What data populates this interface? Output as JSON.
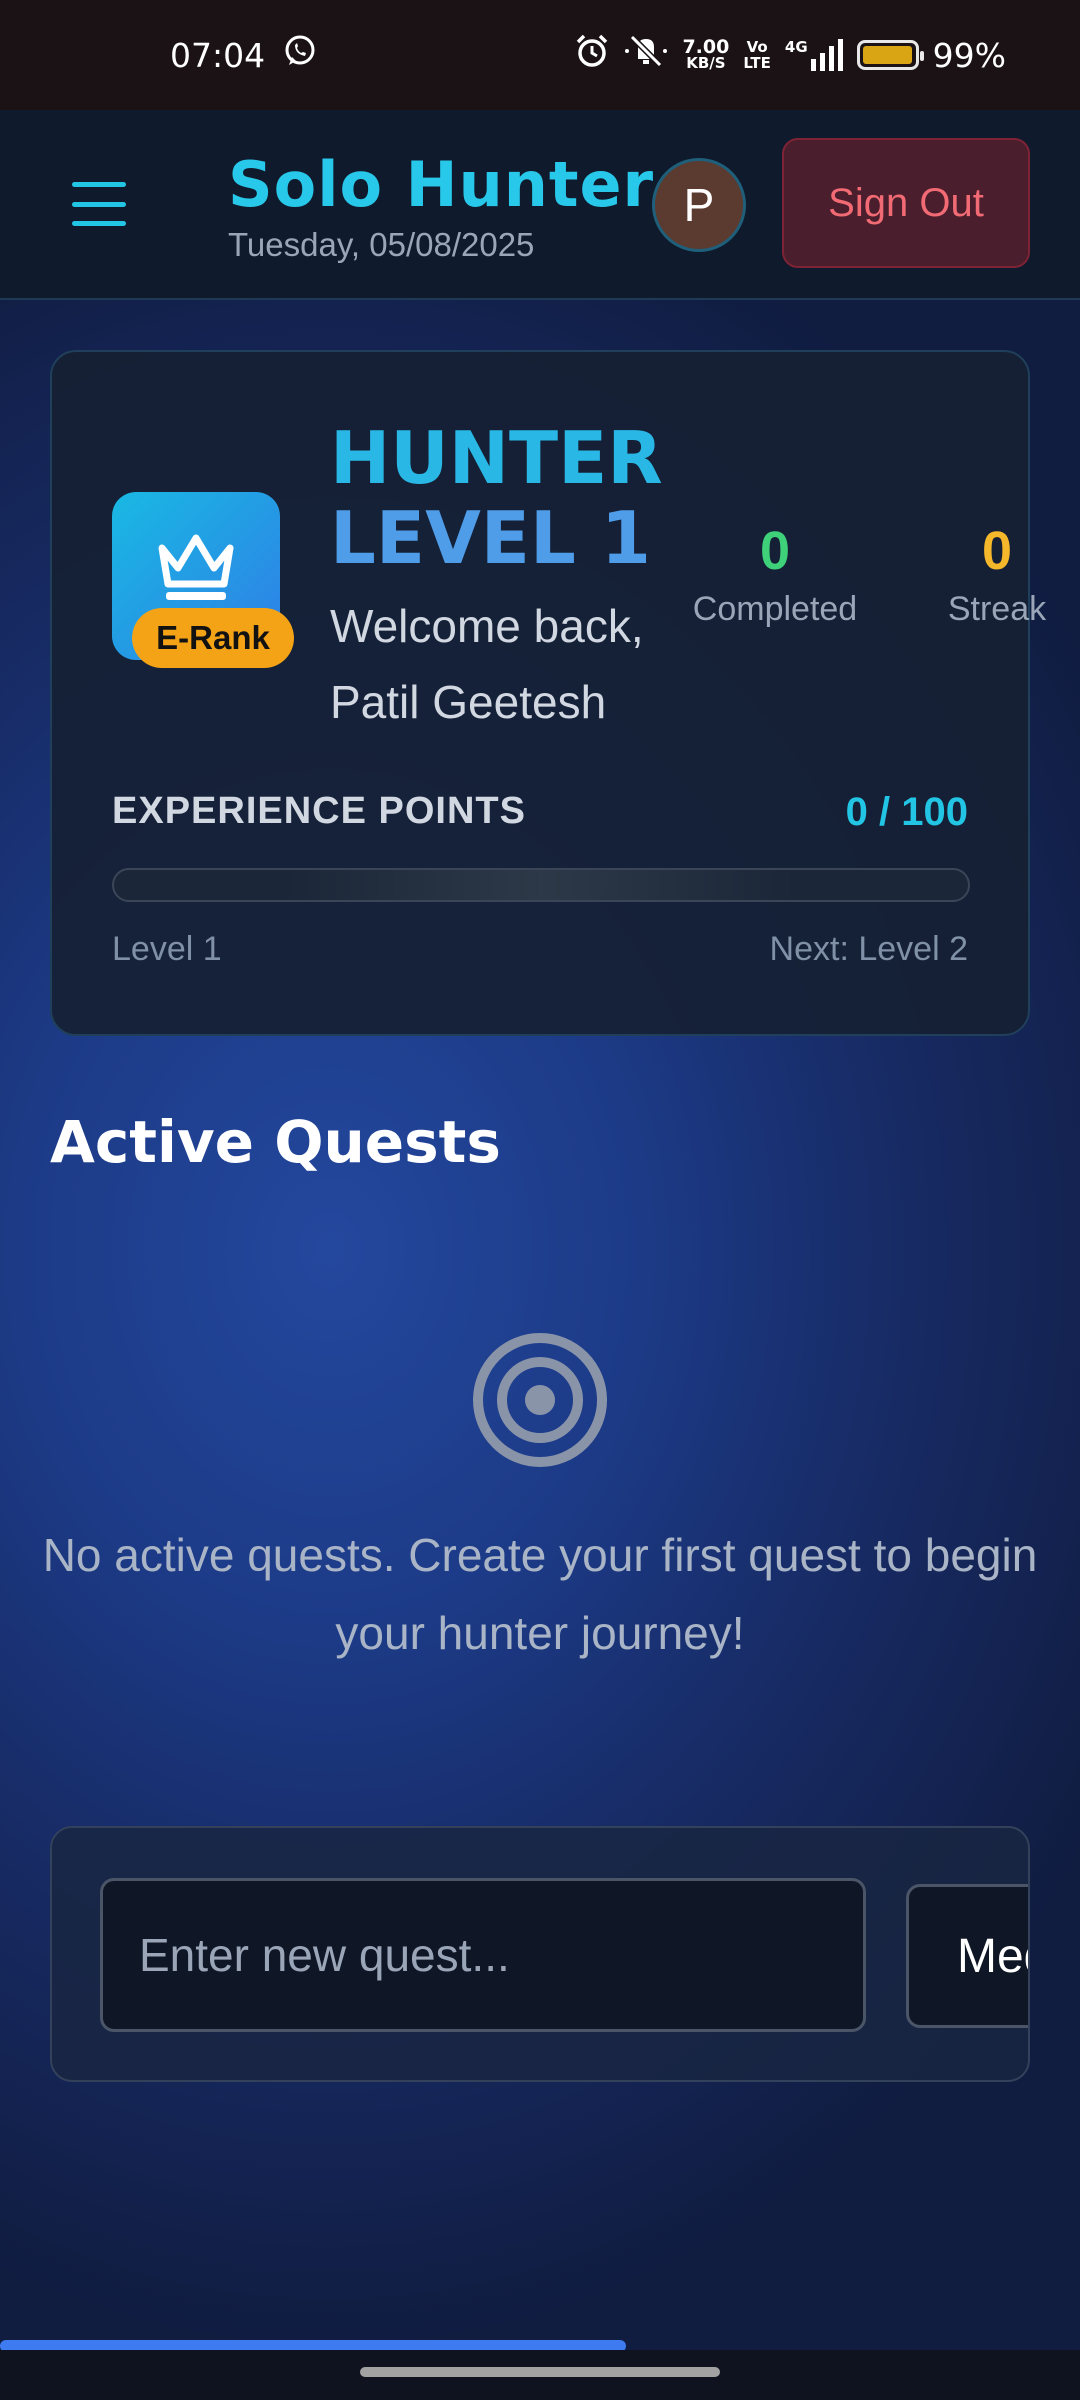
{
  "status_bar": {
    "time": "07:04",
    "net_speed_value": "7.00",
    "net_speed_unit": "KB/S",
    "volte_top": "Vo",
    "volte_bottom": "LTE",
    "network": "4G",
    "battery_text": "99%",
    "battery_level": 0.99,
    "icons": [
      "whatsapp-icon",
      "alarm-icon",
      "mute-icon",
      "signal-icon",
      "battery-icon"
    ]
  },
  "header": {
    "app_title": "Solo Hunter",
    "date": "Tuesday, 05/08/2025",
    "avatar_initial": "P",
    "sign_out_label": "Sign Out",
    "icons": [
      "menu-icon"
    ]
  },
  "hunter_card": {
    "rank_label": "E-Rank",
    "level_line1": "HUNTER",
    "level_line2": "LEVEL 1",
    "welcome_line1": "Welcome back,",
    "welcome_line2": "Patil Geetesh",
    "stats": {
      "completed_value": "0",
      "completed_label": "Completed",
      "streak_value": "0",
      "streak_label": "Streak"
    },
    "xp": {
      "label": "EXPERIENCE POINTS",
      "value_text": "0 / 100",
      "current": 0,
      "max": 100,
      "level_current": "Level 1",
      "level_next": "Next: Level 2"
    },
    "icons": [
      "crown-icon"
    ]
  },
  "quests": {
    "section_title": "Active Quests",
    "empty_message": "No active quests. Create your first quest to begin your hunter journey!",
    "new_quest_placeholder": "Enter new quest...",
    "priority_selected": "Medium",
    "icons": [
      "target-icon"
    ]
  },
  "page_load_progress": 0.58,
  "colors": {
    "accent_cyan": "#22c5e3",
    "sign_out_red": "#f26b74",
    "completed_green": "#3fd07a",
    "streak_yellow": "#f5b82a",
    "rank_orange": "#f5a316"
  }
}
